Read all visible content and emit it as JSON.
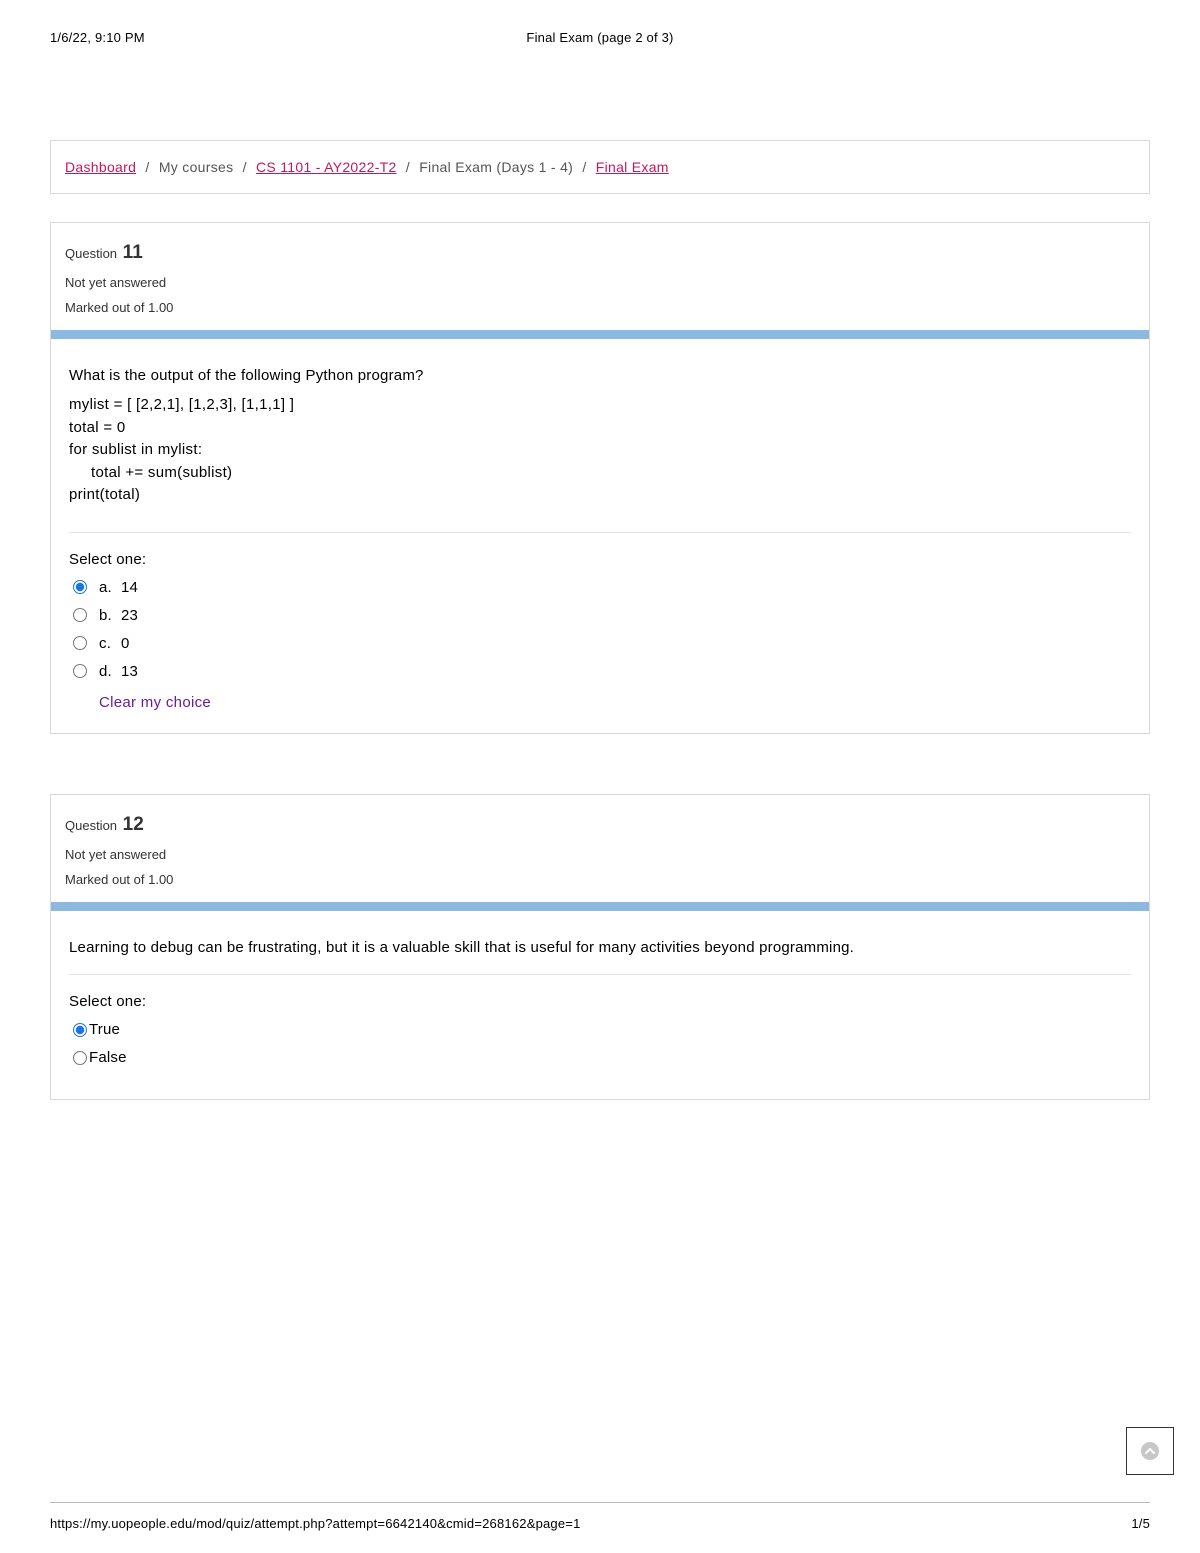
{
  "print": {
    "timestamp": "1/6/22, 9:10 PM",
    "title": "Final Exam (page 2 of 3)",
    "url": "https://my.uopeople.edu/mod/quiz/attempt.php?attempt=6642140&cmid=268162&page=1",
    "pagenum": "1/5"
  },
  "breadcrumb": {
    "dashboard": "Dashboard",
    "sep": "/",
    "mycourses": "My courses",
    "course": "CS 1101 - AY2022-T2",
    "section": "Final Exam (Days 1 - 4)",
    "exam": "Final Exam"
  },
  "q11": {
    "qword": "Question",
    "num": "11",
    "status": "Not yet answered",
    "marks": "Marked out of 1.00",
    "prompt": "What is the output of the following Python program?",
    "code": {
      "l1": "mylist = [ [2,2,1], [1,2,3], [1,1,1] ]",
      "l2": "total = 0",
      "l3": "for sublist in mylist:",
      "l4": "total += sum(sublist)",
      "l5": "print(total)"
    },
    "selectone": "Select one:",
    "options": [
      {
        "letter": "a.",
        "text": "14"
      },
      {
        "letter": "b.",
        "text": "23"
      },
      {
        "letter": "c.",
        "text": "0"
      },
      {
        "letter": "d.",
        "text": "13"
      }
    ],
    "clear": "Clear my choice"
  },
  "q12": {
    "qword": "Question",
    "num": "12",
    "status": "Not yet answered",
    "marks": "Marked out of 1.00",
    "prompt": "Learning to debug can be frustrating, but it is a valuable skill that is useful for many activities beyond programming.",
    "selectone": "Select one:",
    "true": "True",
    "false": "False"
  }
}
